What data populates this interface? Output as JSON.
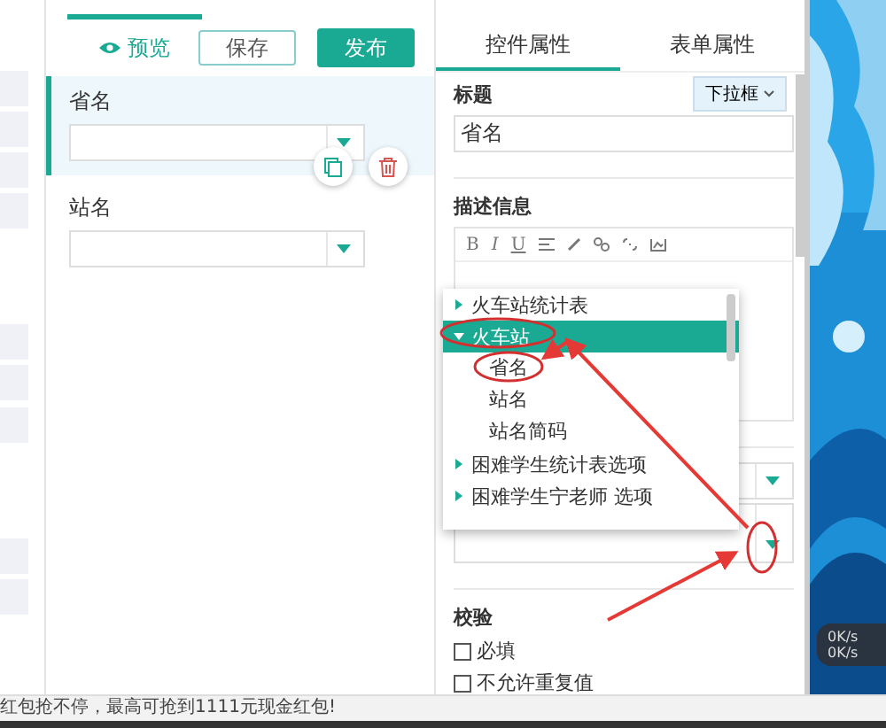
{
  "toolbar": {
    "preview": "预览",
    "save": "保存",
    "publish": "发布"
  },
  "form_fields": [
    {
      "label": "省名",
      "selected": true
    },
    {
      "label": "站名",
      "selected": false
    }
  ],
  "property_tabs": [
    {
      "label": "控件属性",
      "selected": true
    },
    {
      "label": "表单属性",
      "selected": false
    }
  ],
  "title_section": {
    "label": "标题",
    "type_button": "下拉框",
    "value": "省名"
  },
  "description_section": {
    "label": "描述信息",
    "tools": [
      "B",
      "I",
      "U"
    ]
  },
  "dropdown_tree": [
    {
      "label": "火车站统计表",
      "expanded": false,
      "selected": false
    },
    {
      "label": "火车站",
      "expanded": true,
      "selected": true,
      "children": [
        {
          "label": "省名",
          "selected": false
        },
        {
          "label": "站名",
          "selected": false
        },
        {
          "label": "站名简码",
          "selected": false
        }
      ]
    },
    {
      "label": "困难学生统计表选项",
      "expanded": false,
      "selected": false
    },
    {
      "label": "困难学生宁老师 选项",
      "expanded": false,
      "selected": false
    }
  ],
  "validation": {
    "label": "校验",
    "options": [
      {
        "label": "必填",
        "checked": false
      },
      {
        "label": "不允许重复值",
        "checked": false
      }
    ]
  },
  "status_bar": "红包抢不停，最高可抢到1111元现金红包!",
  "network_speed": [
    "0K/s",
    "0K/s"
  ]
}
